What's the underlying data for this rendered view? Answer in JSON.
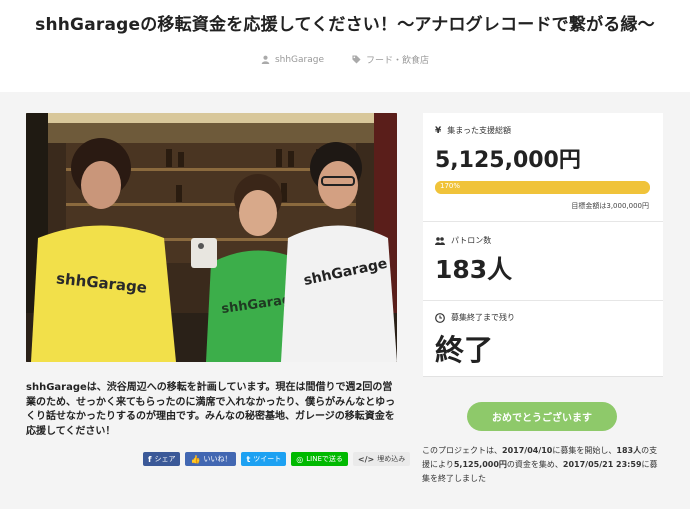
{
  "title": "shhGarageの移転資金を応援してください！～アナログレコードで繋がる縁～",
  "meta": {
    "owner": "shhGarage",
    "category": "フード・飲食店",
    "owner_icon": "user-icon",
    "category_icon": "tag-icon"
  },
  "description": "shhGarageは、渋谷周辺への移転を計画しています。現在は間借りで週2回の営業のため、せっかく来てもらったのに満席で入れなかったり、僕らがみんなとゆっくり話せなかったりするのが理由です。みんなの秘密基地、ガレージの移転資金を応援してください！",
  "share": {
    "facebook": "シェア",
    "like": "いいね！",
    "twitter": "ツイート",
    "line": "LINEで送る",
    "embed": "埋め込み"
  },
  "stats": {
    "raised_label": "集まった支援総額",
    "raised_value": "5,125,000円",
    "progress_text": "170%",
    "progress_percent": 170,
    "goal_text": "目標金額は3,000,000円",
    "backers_label": "パトロン数",
    "backers_value": "183人",
    "remaining_label": "募集終了まで残り",
    "remaining_value": "終了"
  },
  "cta": {
    "label": "おめでとうございます"
  },
  "end_note": {
    "p1": "このプロジェクトは、",
    "start_date": "2017/04/10",
    "p2": "に募集を開始し、",
    "backers": "183人",
    "p3": "の支援により",
    "amount": "5,125,000円",
    "p4": "の資金を集め、",
    "end_date": "2017/05/21 23:59",
    "p5": "に募集を終了しました"
  },
  "colors": {
    "accent_yellow": "#f0c33a",
    "congrats_green": "#8ec96a",
    "facebook": "#3b5998",
    "twitter": "#1da1f2",
    "line": "#00b900"
  },
  "photo": {
    "shirt_text_left": "shhGarage",
    "shirt_text_center": "shhGarage",
    "shirt_text_right": "shhGarage"
  }
}
